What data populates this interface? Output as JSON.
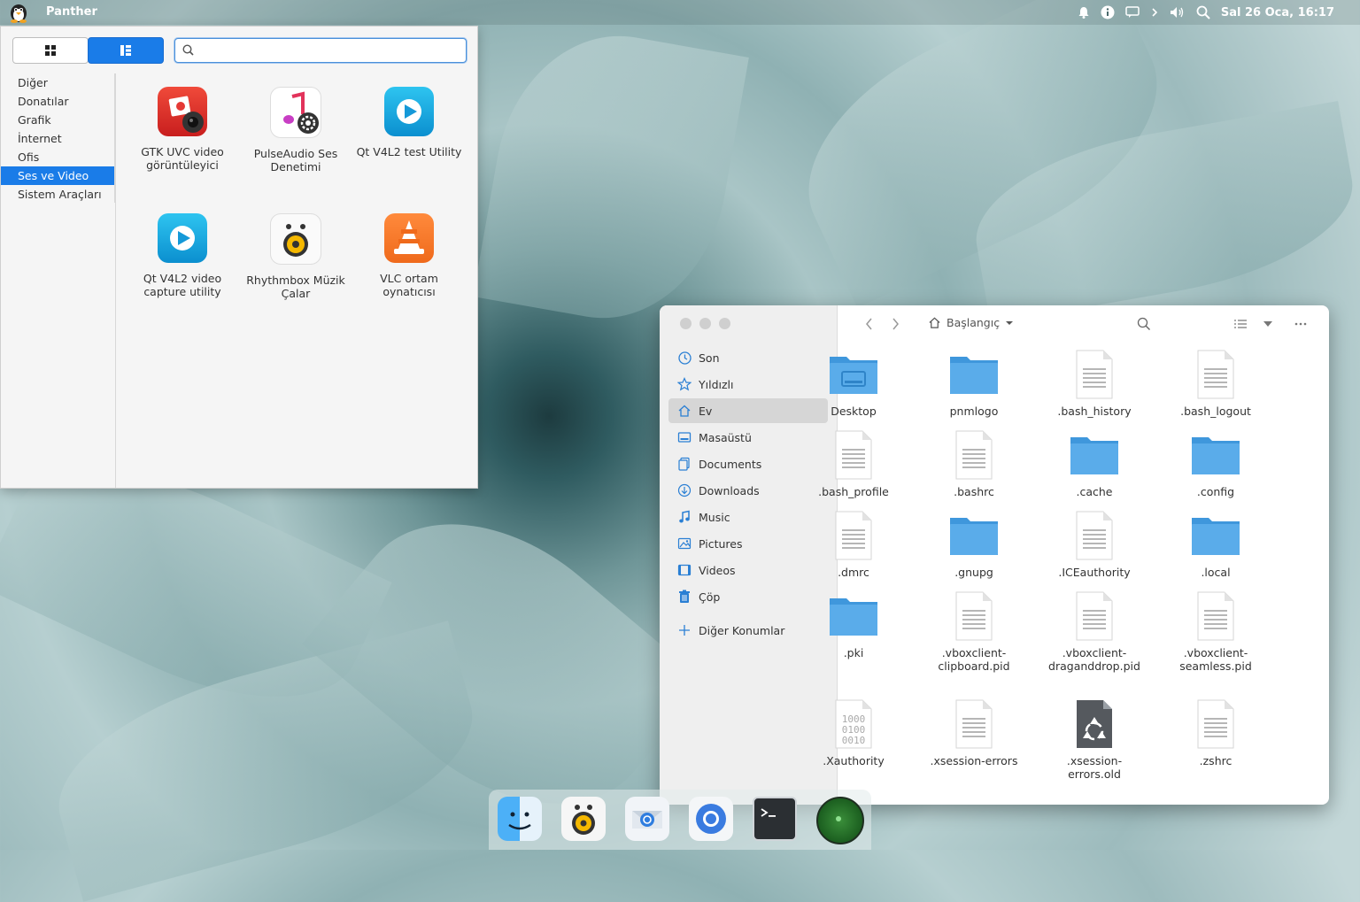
{
  "top_panel": {
    "app_name": "Panther",
    "clock": "Sal 26 Oca, 16:17",
    "tray_icons": [
      "bell-icon",
      "info-icon",
      "message-icon",
      "chevron-right-icon",
      "volume-icon",
      "search-icon"
    ]
  },
  "app_menu": {
    "search": {
      "value": "",
      "placeholder": ""
    },
    "categories": [
      "Diğer",
      "Donatılar",
      "Grafik",
      "İnternet",
      "Ofis",
      "Ses ve Video",
      "Sistem Araçları"
    ],
    "selected_category": "Ses ve Video",
    "apps": [
      {
        "label": "GTK UVC video görüntüleyici",
        "icon": "webcam-icon"
      },
      {
        "label": "PulseAudio Ses Denetimi",
        "icon": "music-settings-icon"
      },
      {
        "label": "Qt V4L2 test Utility",
        "icon": "play-icon"
      },
      {
        "label": "Qt V4L2 video capture utility",
        "icon": "play-icon"
      },
      {
        "label": "Rhythmbox Müzik Çalar",
        "icon": "speaker-icon"
      },
      {
        "label": "VLC ortam oynatıcısı",
        "icon": "vlc-cone-icon"
      }
    ]
  },
  "file_manager": {
    "location": "Başlangıç",
    "sidebar": [
      {
        "label": "Son",
        "icon": "clock-icon"
      },
      {
        "label": "Yıldızlı",
        "icon": "star-icon"
      },
      {
        "label": "Ev",
        "icon": "home-icon",
        "selected": true
      },
      {
        "label": "Masaüstü",
        "icon": "desktop-icon"
      },
      {
        "label": "Documents",
        "icon": "documents-icon"
      },
      {
        "label": "Downloads",
        "icon": "download-icon"
      },
      {
        "label": "Music",
        "icon": "music-icon"
      },
      {
        "label": "Pictures",
        "icon": "pictures-icon"
      },
      {
        "label": "Videos",
        "icon": "video-icon"
      },
      {
        "label": "Çöp",
        "icon": "trash-icon"
      }
    ],
    "other_locations": "Diğer Konumlar",
    "files": [
      {
        "name": "Desktop",
        "type": "folder-desktop"
      },
      {
        "name": "pnmlogo",
        "type": "folder"
      },
      {
        "name": ".bash_history",
        "type": "text"
      },
      {
        "name": ".bash_logout",
        "type": "text"
      },
      {
        "name": ".bash_profile",
        "type": "text"
      },
      {
        "name": ".bashrc",
        "type": "text"
      },
      {
        "name": ".cache",
        "type": "folder"
      },
      {
        "name": ".config",
        "type": "folder"
      },
      {
        "name": ".dmrc",
        "type": "text"
      },
      {
        "name": ".gnupg",
        "type": "folder"
      },
      {
        "name": ".ICEauthority",
        "type": "text"
      },
      {
        "name": ".local",
        "type": "folder"
      },
      {
        "name": ".pki",
        "type": "folder"
      },
      {
        "name": ".vboxclient-clipboard.pid",
        "type": "text"
      },
      {
        "name": ".vboxclient-draganddrop.pid",
        "type": "text"
      },
      {
        "name": ".vboxclient-seamless.pid",
        "type": "text"
      },
      {
        "name": ".Xauthority",
        "type": "binary",
        "binary_text": [
          "1000",
          "0100",
          "0010"
        ]
      },
      {
        "name": ".xsession-errors",
        "type": "text"
      },
      {
        "name": ".xsession-errors.old",
        "type": "recycle"
      },
      {
        "name": ".zshrc",
        "type": "text"
      }
    ]
  },
  "dock": [
    "finder-icon",
    "rhythmbox-icon",
    "mail-icon",
    "browser-icon",
    "terminal-icon",
    "radar-icon"
  ],
  "colors": {
    "accent": "#1a7ce8",
    "folder": "#5aacea",
    "vlc": "#f0762a"
  }
}
